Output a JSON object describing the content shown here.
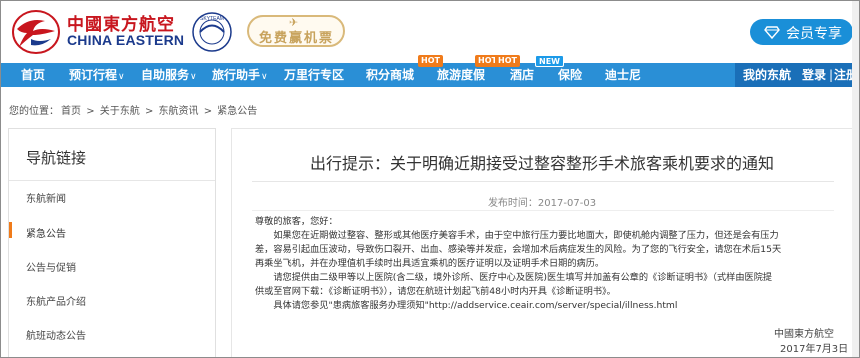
{
  "header": {
    "logo_cn": "中國東方航空",
    "logo_en": "CHINA EASTERN",
    "skyteam": "SKYTEAM",
    "free_ticket": "免费赢机票",
    "member_button": "会员专享"
  },
  "nav": {
    "items": [
      {
        "label": "首页"
      },
      {
        "label": "预订行程",
        "caret": "∨"
      },
      {
        "label": "自助服务",
        "caret": "∨"
      },
      {
        "label": "旅行助手",
        "caret": "∨"
      },
      {
        "label": "万里行专区"
      },
      {
        "label": "积分商城",
        "badge": "HOT"
      },
      {
        "label": "旅游度假",
        "badge": "HOT"
      },
      {
        "label": "酒店",
        "badge": "HOT"
      },
      {
        "label": "保险",
        "badge": "NEW"
      },
      {
        "label": "迪士尼"
      }
    ],
    "my_eastern": "我的东航",
    "login": "登录",
    "separator": "|",
    "register": "注册"
  },
  "breadcrumb": {
    "prefix": "您的位置：",
    "items": [
      "首页",
      "关于东航",
      "东航资讯",
      "紧急公告"
    ],
    "separator": ">"
  },
  "sidebar": {
    "title": "导航链接",
    "items": [
      "东航新闻",
      "紧急公告",
      "公告与促销",
      "东航产品介绍",
      "航班动态公告"
    ],
    "active_index": 1
  },
  "article": {
    "title": "出行提示：关于明确近期接受过整容整形手术旅客乘机要求的通知",
    "date": "发布时间：2017-07-03",
    "lines": [
      "尊敬的旅客，您好：",
      "　　如果您在近期做过整容、整形或其他医疗美容手术，由于空中旅行压力要比地面大，即使机舱内调整了压力，但还是会有压力",
      "差，容易引起血压波动，导致伤口裂开、出血、感染等并发症，会增加术后病症发生的风险。为了您的飞行安全，请您在术后15天",
      "再乘坐飞机，并在办理值机手续时出具适宜乘机的医疗证明以及证明手术日期的病历。",
      "　　请您提供由二级甲等以上医院(含二级，境外诊所、医疗中心及医院)医生填写并加盖有公章的《诊断证明书》（式样由医院提",
      "供或至官网下载：《诊断证明书》），请您在航班计划起飞前48小时内开具《诊断证明书》。",
      "　　具体请您参见\"患病旅客服务办理须知\"http://addservice.ceair.com/server/special/illness.html"
    ],
    "signature": "中國東方航空",
    "sign_date": "2017年7月3日"
  },
  "colors": {
    "brand_red": "#c8161e",
    "brand_blue": "#1b3a8c",
    "nav_blue": "#2a8fd6",
    "hot_badge": "#f07b1a",
    "member_button": "#1a8fd8"
  }
}
